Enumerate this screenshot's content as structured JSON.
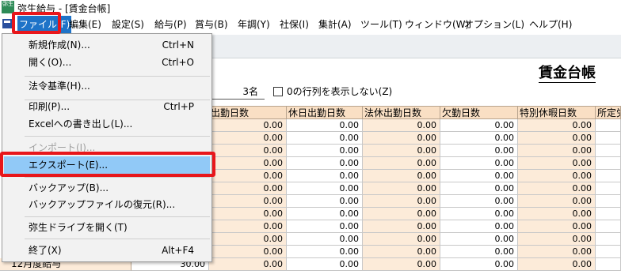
{
  "window": {
    "app_icon_text": "弥生",
    "title": "弥生給与 - [賃金台帳]"
  },
  "menubar": {
    "items": [
      {
        "label": "ファイル(F)"
      },
      {
        "label": "編集(E)"
      },
      {
        "label": "設定(S)"
      },
      {
        "label": "給与(P)"
      },
      {
        "label": "賞与(B)"
      },
      {
        "label": "年調(Y)"
      },
      {
        "label": "社保(I)"
      },
      {
        "label": "集計(A)"
      },
      {
        "label": "ツール(T)"
      },
      {
        "label": "ウィンドウ(W)"
      },
      {
        "label": "オプション(L)"
      },
      {
        "label": "ヘルプ(H)"
      }
    ]
  },
  "file_menu": {
    "new": {
      "label": "新規作成(N)...",
      "shortcut": "Ctrl+N"
    },
    "open": {
      "label": "開く(O)...",
      "shortcut": "Ctrl+O"
    },
    "law": {
      "label": "法令基準(H)..."
    },
    "print": {
      "label": "印刷(P)...",
      "shortcut": "Ctrl+P"
    },
    "excel": {
      "label": "Excelへの書き出し(L)..."
    },
    "import": {
      "label": "インポート(I)..."
    },
    "export": {
      "label": "エクスポート(E)..."
    },
    "backup": {
      "label": "バックアップ(B)..."
    },
    "restore": {
      "label": "バックアップファイルの復元(R)..."
    },
    "drive": {
      "label": "弥生ドライブを開く(T)"
    },
    "exit": {
      "label": "終了(X)",
      "shortcut": "Alt+F4"
    }
  },
  "report": {
    "title": "賃金台帳",
    "count": "3名",
    "hide_zero_label": "0の行列を表示しない(Z)"
  },
  "grid": {
    "columns": [
      "出勤日数",
      "休日出勤日数",
      "法休出勤日数",
      "欠勤日数",
      "特別休暇日数",
      "所定労"
    ],
    "cell_value": "0.00",
    "last_row": {
      "label": "12月度給与",
      "value": "30.00"
    }
  },
  "colors": {
    "accent": "#1e73c8",
    "highlight": "#91c9f7",
    "annotation": "#e8161b",
    "header_bg": "#f9dfc4"
  }
}
